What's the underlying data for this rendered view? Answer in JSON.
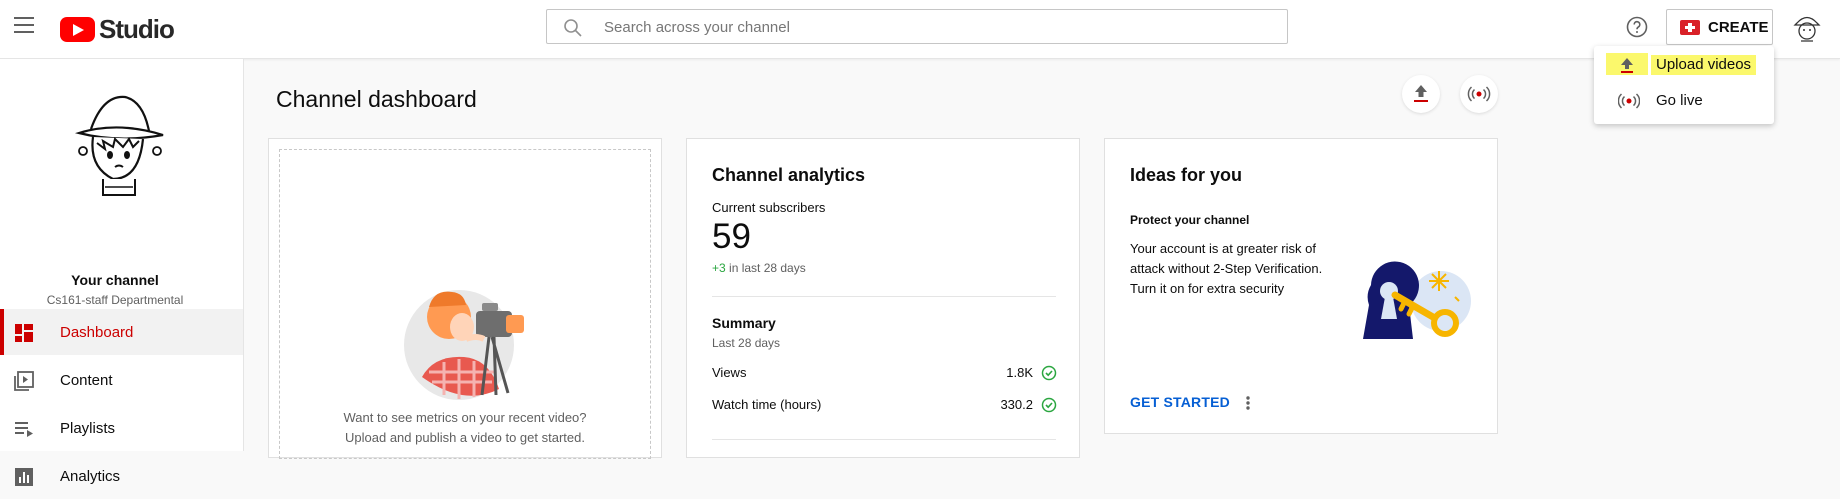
{
  "header": {
    "logo_text": "Studio",
    "search_placeholder": "Search across your channel",
    "create_label": "CREATE"
  },
  "create_menu": {
    "items": [
      {
        "label": "Upload videos",
        "icon": "upload-icon"
      },
      {
        "label": "Go live",
        "icon": "live-icon"
      }
    ]
  },
  "sidebar": {
    "your_channel": "Your channel",
    "channel_name": "Cs161-staff Departmental",
    "items": [
      {
        "label": "Dashboard",
        "icon": "dashboard-icon",
        "active": true
      },
      {
        "label": "Content",
        "icon": "content-icon"
      },
      {
        "label": "Playlists",
        "icon": "playlists-icon"
      },
      {
        "label": "Analytics",
        "icon": "analytics-icon"
      }
    ]
  },
  "main": {
    "page_title": "Channel dashboard",
    "upload_hint_line1": "Want to see metrics on your recent video?",
    "upload_hint_line2": "Upload and publish a video to get started."
  },
  "analytics": {
    "title": "Channel analytics",
    "current_subscribers_label": "Current subscribers",
    "subscribers": "59",
    "delta": "+3",
    "delta_suffix": " in last 28 days",
    "summary_title": "Summary",
    "summary_period": "Last 28 days",
    "rows": [
      {
        "label": "Views",
        "value": "1.8K"
      },
      {
        "label": "Watch time (hours)",
        "value": "330.2"
      }
    ]
  },
  "ideas": {
    "title": "Ideas for you",
    "heading": "Protect your channel",
    "text": "Your account is at greater risk of attack without 2-Step Verification. Turn it on for extra security",
    "cta": "GET STARTED"
  },
  "colors": {
    "accent_red": "#cc0000",
    "link_blue": "#065fd4",
    "highlight_yellow": "#fbf86c",
    "check_green": "#2ba640"
  }
}
